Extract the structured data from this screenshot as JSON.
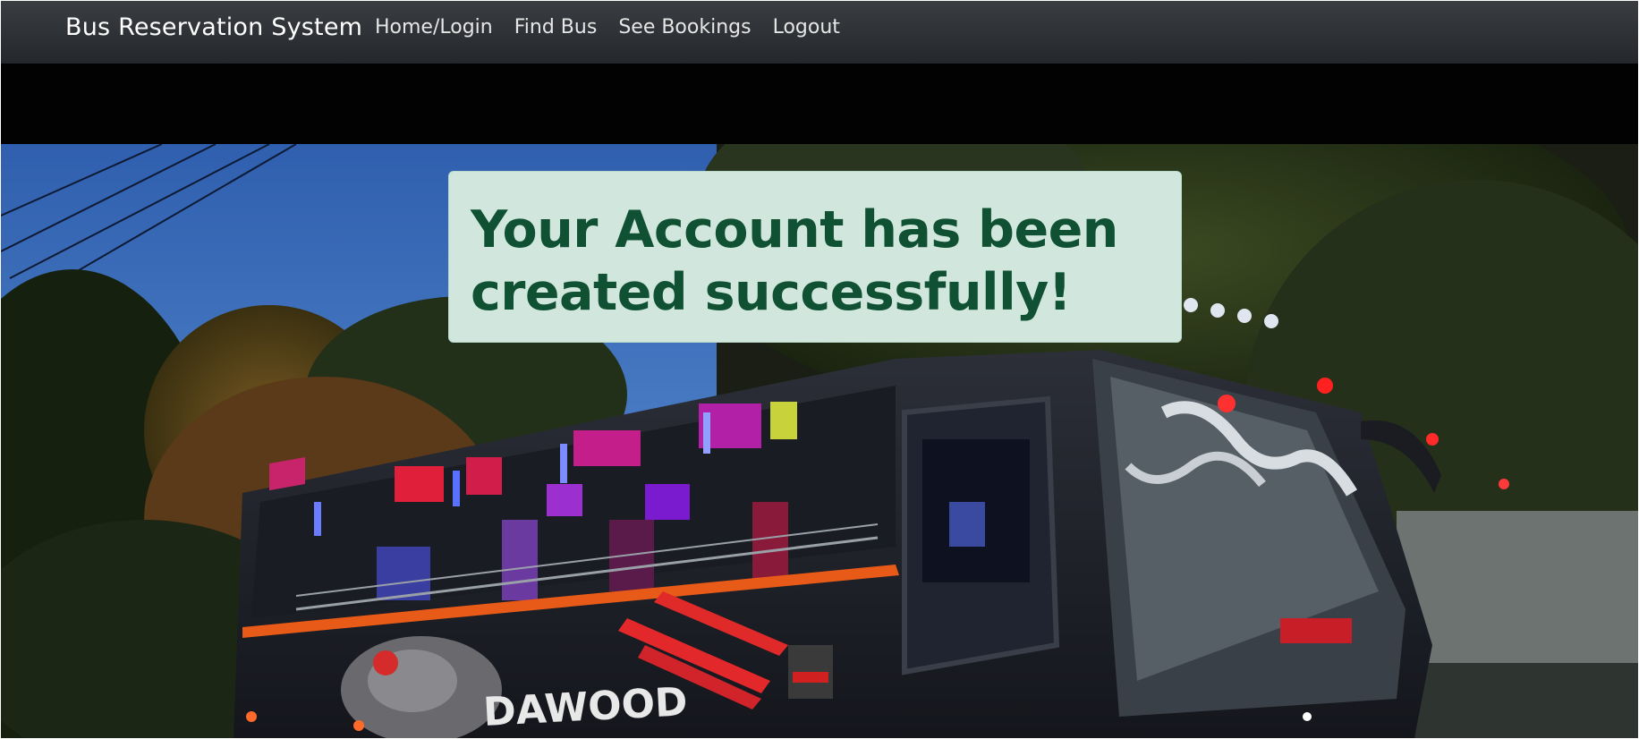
{
  "navbar": {
    "brand": "Bus Reservation System",
    "links": [
      {
        "label": "Home/Login"
      },
      {
        "label": "Find Bus"
      },
      {
        "label": "See Bookings"
      },
      {
        "label": "Logout"
      }
    ]
  },
  "alert": {
    "message": "Your Account has been created successfully!",
    "type": "success"
  },
  "hero": {
    "image": "night-bus-photo",
    "bus_lettering": "DAWOOD"
  },
  "colors": {
    "navbar": "#2f3236",
    "alert_bg": "#d1e7dd",
    "alert_text": "#0f5132",
    "sky": "#3a6fb8"
  }
}
